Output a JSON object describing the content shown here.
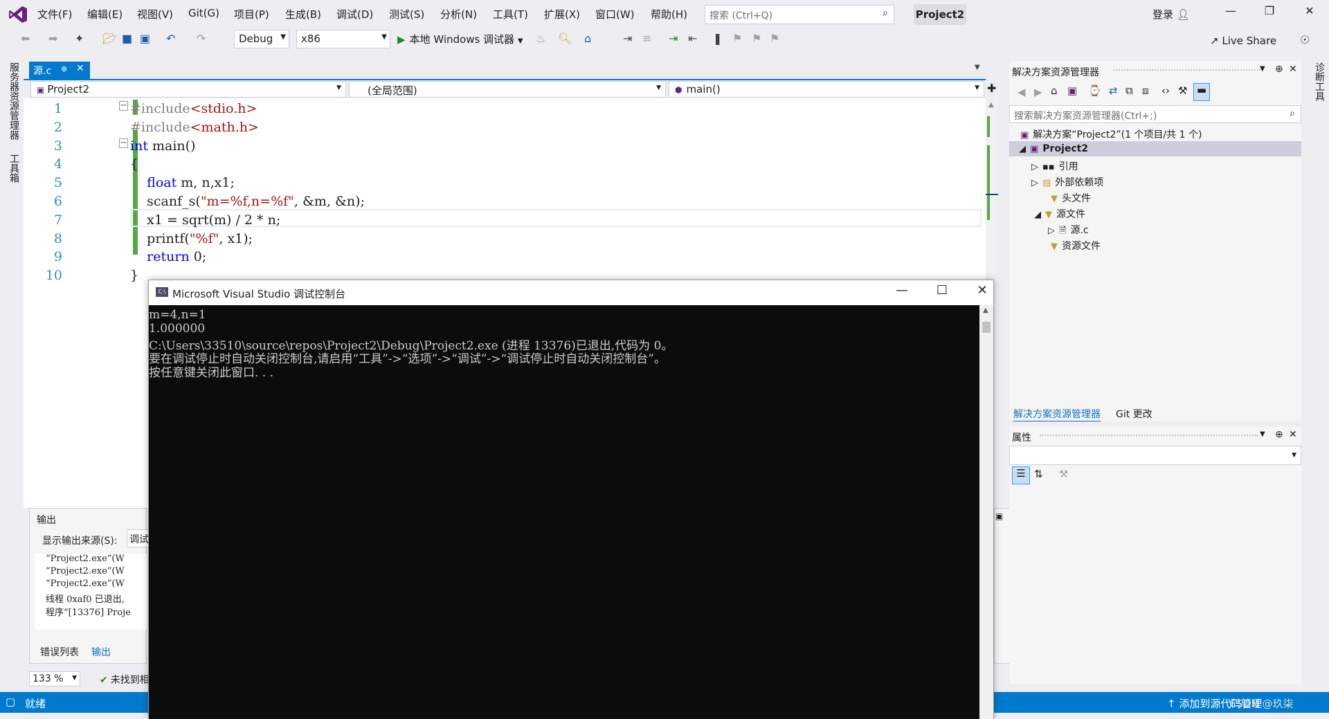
{
  "menu": [
    "文件(F)",
    "编辑(E)",
    "视图(V)",
    "Git(G)",
    "项目(P)",
    "生成(B)",
    "调试(D)",
    "测试(S)",
    "分析(N)",
    "工具(T)",
    "扩展(X)",
    "窗口(W)",
    "帮助(H)"
  ],
  "search": {
    "placeholder": "搜索 (Ctrl+Q)"
  },
  "project_title": "Project2",
  "login": "登录",
  "toolbar": {
    "config": "Debug",
    "platform": "x86",
    "run_label": "本地 Windows 调试器",
    "live_share": "Live Share"
  },
  "left_rail": {
    "server_explorer": "服务器资源管理器",
    "toolbox": "工具箱"
  },
  "right_rail": {
    "diagnostics": "诊断工具"
  },
  "doc_tab": {
    "name": "源.c"
  },
  "nav": {
    "project": "Project2",
    "scope": "(全局范围)",
    "member": "main()"
  },
  "code": {
    "line_numbers": [
      "1",
      "2",
      "3",
      "4",
      "5",
      "6",
      "7",
      "8",
      "9",
      "10"
    ],
    "lines": [
      {
        "t": "#include<stdio.h>",
        "k": "pp"
      },
      {
        "t": "#include<math.h>",
        "k": "pp"
      },
      {
        "t": "int main()",
        "k": "fn"
      },
      {
        "t": "{",
        "k": "plain"
      },
      {
        "t": "    float m, n,x1;",
        "k": "decl"
      },
      {
        "t": "    scanf_s(\"m=%f,n=%f\", &m, &n);",
        "k": "call"
      },
      {
        "t": "    x1 = sqrt(m) / 2 * n;",
        "k": "plain"
      },
      {
        "t": "    printf(\"%f\", x1);",
        "k": "call2"
      },
      {
        "t": "    return 0;",
        "k": "ret"
      },
      {
        "t": "}",
        "k": "plain"
      }
    ]
  },
  "output": {
    "title": "输出",
    "source_label": "显示输出来源(S):",
    "source_value": "调试",
    "lines": [
      "“Project2.exe”(W",
      "“Project2.exe”(W",
      "“Project2.exe”(W",
      "线程 0xaf0 已退出,",
      "程序“[13376] Proje"
    ],
    "tabs": [
      "错误列表",
      "输出"
    ]
  },
  "zoom": "133 %",
  "issues": "未找到相",
  "status": {
    "ready": "就绪",
    "source_control": "添加到源代码管理"
  },
  "solution_explorer": {
    "title": "解决方案资源管理器",
    "search_placeholder": "搜索解决方案资源管理器(Ctrl+;)",
    "items": [
      {
        "label": "解决方案“Project2”(1 个项目/共 1 个)"
      },
      {
        "label": "Project2"
      },
      {
        "label": "引用"
      },
      {
        "label": "外部依赖项"
      },
      {
        "label": "头文件"
      },
      {
        "label": "源文件"
      },
      {
        "label": "源.c"
      },
      {
        "label": "资源文件"
      }
    ],
    "tabs": [
      "解决方案资源管理器",
      "Git 更改"
    ]
  },
  "properties": {
    "title": "属性"
  },
  "console": {
    "title": "Microsoft Visual Studio 调试控制台",
    "lines": [
      "m=4,n=1",
      "1.000000",
      "C:\\Users\\33510\\source\\repos\\Project2\\Debug\\Project2.exe (进程 13376)已退出,代码为 0。",
      "要在调试停止时自动关闭控制台,请启用“工具”->“选项”->“调试”->“调试停止时自动关闭控制台”。",
      "按任意键关闭此窗口. . ."
    ]
  },
  "watermark": "CSDN @玖柒"
}
